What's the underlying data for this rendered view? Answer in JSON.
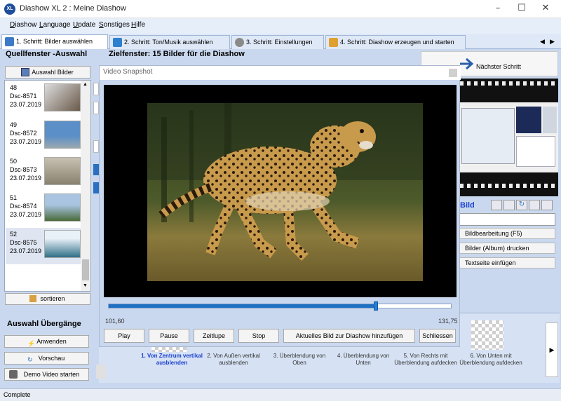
{
  "window": {
    "title": "Diashow XL 2 : Meine Diashow",
    "app_icon_text": "XL"
  },
  "menu": [
    "Diashow",
    "Language",
    "Update",
    "Sonstiges",
    "Hilfe"
  ],
  "tabs": [
    {
      "label": "1. Schritt: Bilder auswählen",
      "active": true
    },
    {
      "label": "2. Schritt: Ton/Musik auswählen",
      "active": false
    },
    {
      "label": "3. Schritt: Einstellungen",
      "active": false
    },
    {
      "label": "4. Schritt: Diashow erzeugen und starten",
      "active": false
    }
  ],
  "left": {
    "header": "Quellfenster -Auswahl",
    "select_button": "Auswahl Bilder",
    "items": [
      {
        "num": "48",
        "name": "Dsc-8571",
        "date": "23.07.2019",
        "thumb_color": "#6a5a4a"
      },
      {
        "num": "49",
        "name": "Dsc-8572",
        "date": "23.07.2019",
        "thumb_color": "#5b8fc8"
      },
      {
        "num": "50",
        "name": "Dsc-8573",
        "date": "23.07.2019",
        "thumb_color": "#8a8270"
      },
      {
        "num": "51",
        "name": "Dsc-8574",
        "date": "23.07.2019",
        "thumb_color": "#4a6a3a"
      },
      {
        "num": "52",
        "name": "Dsc-8575",
        "date": "23.07.2019",
        "thumb_color": "#2f6f86"
      }
    ],
    "sort_button": "sortieren"
  },
  "transitions_panel": {
    "header": "Auswahl Übergänge",
    "apply": "Anwenden",
    "preview": "Vorschau",
    "demo": "Demo Video starten"
  },
  "main": {
    "header": "Zielfenster: 15 Bilder für die Diashow"
  },
  "right": {
    "next_step": "Nächster Schritt",
    "bild_label": "Bild",
    "edit": "Bildbearbeitung (F5)",
    "print": "Bilder (Album) drucken",
    "text_page": "Textseite einfügen"
  },
  "dialog": {
    "title": "Video Snapshot",
    "time_start": "101,60",
    "time_end": "131,75",
    "progress_fraction": 0.78,
    "buttons": {
      "play": "Play",
      "pause": "Pause",
      "slow": "Zeitlupe",
      "stop": "Stop",
      "add": "Aktuelles Bild zur Diashow hinzufügen",
      "close": "Schliessen"
    }
  },
  "transitions": [
    {
      "label": "1. Von Zentrum vertikal ausblenden",
      "selected": true
    },
    {
      "label": "2. Von Außen vertikal ausblenden",
      "selected": false
    },
    {
      "label": "3. Überblendung von Oben",
      "selected": false
    },
    {
      "label": "4. Überblendung von Unten",
      "selected": false
    },
    {
      "label": "5. Von Rechts mit Überblendung aufdecken",
      "selected": false
    },
    {
      "label": "6. Von Unten mit Überblendung aufdecken",
      "selected": false
    }
  ],
  "status": "Complete"
}
